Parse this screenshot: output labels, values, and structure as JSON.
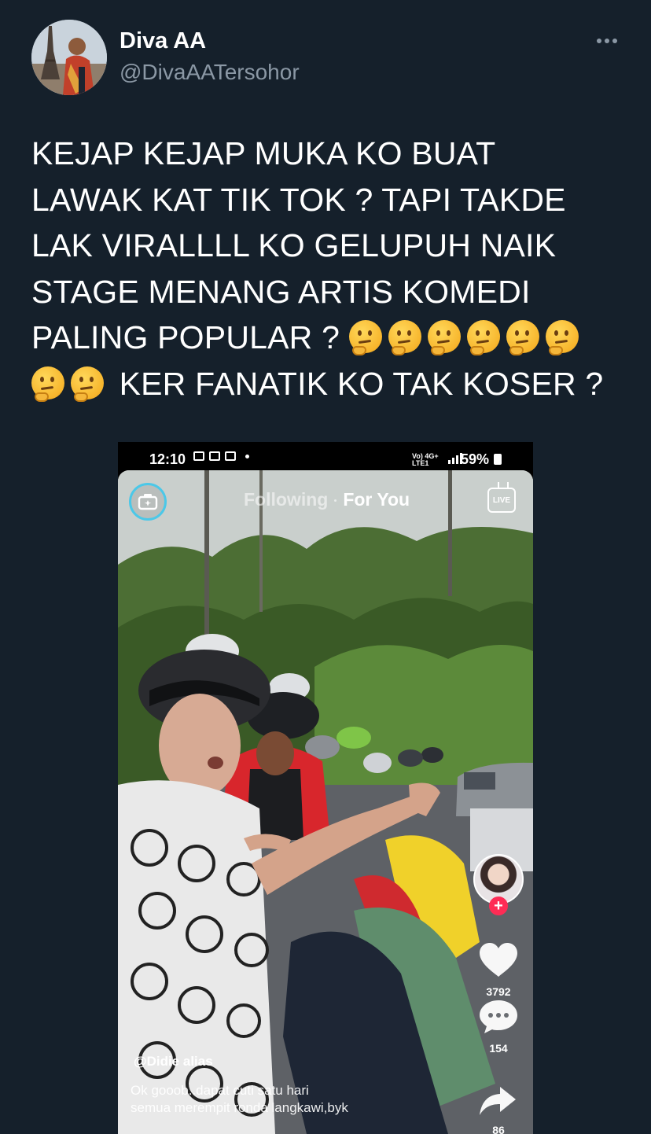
{
  "tweet": {
    "author": {
      "display_name": "Diva AA",
      "handle": "@DivaAATersohor",
      "avatar_icon": "avatar-eiffel-tower-photo"
    },
    "more_icon": "more-options-icon",
    "text_lines": [
      "KEJAP KEJAP MUKA KO BUAT",
      "LAWAK KAT TIK TOK ? TAPI TAKDE",
      "LAK VIRALLLL KO GELUPUH NAIK",
      "STAGE MENANG ARTIS KOMEDI",
      "PALING POPULAR ? ",
      " KER FANATIK KO TAK KOSER ?"
    ],
    "emoji_name": "thinking-face",
    "emoji_count_line5": 6,
    "emoji_count_line6": 2
  },
  "media": {
    "phone_status": {
      "time": "12:10",
      "network_label": "Vo) 4G+ LTE1",
      "battery": "59%"
    },
    "tiktok": {
      "tab_following": "Following",
      "tab_for_you": "For You",
      "live_label": "LIVE",
      "likes": "3792",
      "comments": "154",
      "shares": "86",
      "username": "@Didie alias",
      "caption_lines": [
        "Ok gooob..dapat cuti satu hari",
        "semua merempit ronda langkawi,byk"
      ],
      "accent_color": "#fe2c55",
      "camera_ring_color": "#4bc8e8"
    }
  },
  "colors": {
    "background": "#15202b",
    "secondary_text": "#8b98a5"
  }
}
